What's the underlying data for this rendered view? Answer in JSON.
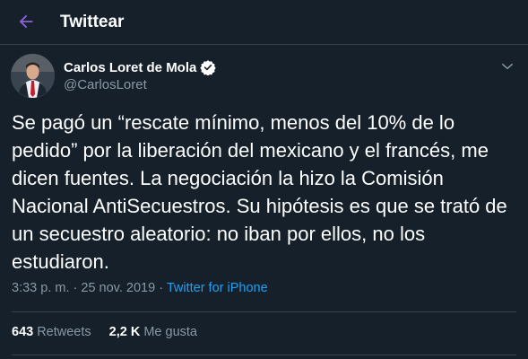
{
  "header": {
    "title": "Twittear",
    "back_icon": "arrow-left-icon"
  },
  "tweet": {
    "author": {
      "name": "Carlos Loret de Mola",
      "handle": "@CarlosLoret",
      "verified_icon": "verified-badge-icon"
    },
    "text": "Se pagó un “rescate mínimo, menos del 10% de lo\npedido” por la liberación del mexicano y el francés, me\ndicen fuentes. La negociación la hizo la Comisión\nNacional AntiSecuestros. Su hipótesis es que se trató de\nun secuestro aleatorio: no iban por ellos, no los\nestudiaron.",
    "time": "3:33 p. m.",
    "separator": "·",
    "date": "25 nov. 2019",
    "source": "Twitter for iPhone",
    "retweets_count": "643",
    "retweets_label": "Retweets",
    "likes_count": "2,2 K",
    "likes_label": "Me gusta"
  },
  "colors": {
    "background": "#15202b",
    "accent": "#1da1f2",
    "secondary_text": "#8899a6",
    "border": "#38444d",
    "back_arrow": "#8b62d6"
  }
}
